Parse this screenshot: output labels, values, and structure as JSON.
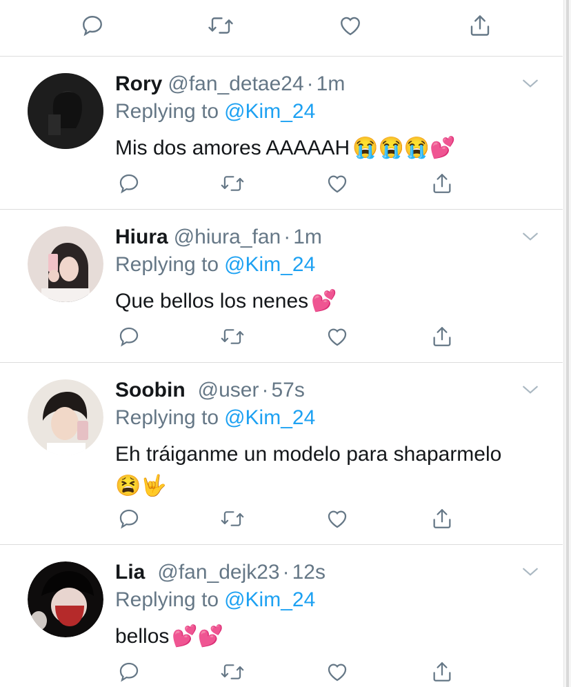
{
  "colors": {
    "text": "#14171a",
    "muted": "#657786",
    "link": "#1da1f2",
    "divider": "#dcdcdc"
  },
  "top_actions": [
    "reply-icon",
    "retweet-icon",
    "like-icon",
    "share-icon"
  ],
  "replies": [
    {
      "name": "Rory",
      "handle": "@fan_detae24",
      "time": "1m",
      "replying_prefix": "Replying to",
      "mention": "@Kim_24",
      "text": "Mis dos amores AAAAAH",
      "emoji": "😭😭😭💕"
    },
    {
      "name": "Hiura",
      "handle": "@hiura_fan",
      "time": "1m",
      "replying_prefix": "Replying to",
      "mention": "@Kim_24",
      "text": "Que bellos los nenes",
      "emoji": "💕"
    },
    {
      "name": "Soobin",
      "handle": "@user",
      "time": "57s",
      "replying_prefix": "Replying to",
      "mention": "@Kim_24",
      "text": "Eh tráiganme un modelo para shaparmelo",
      "emoji": "😫🤟"
    },
    {
      "name": "Lia",
      "handle": "@fan_dejk23",
      "time": "12s",
      "replying_prefix": "Replying to",
      "mention": "@Kim_24",
      "text": "bellos",
      "emoji": "💕💕"
    }
  ]
}
